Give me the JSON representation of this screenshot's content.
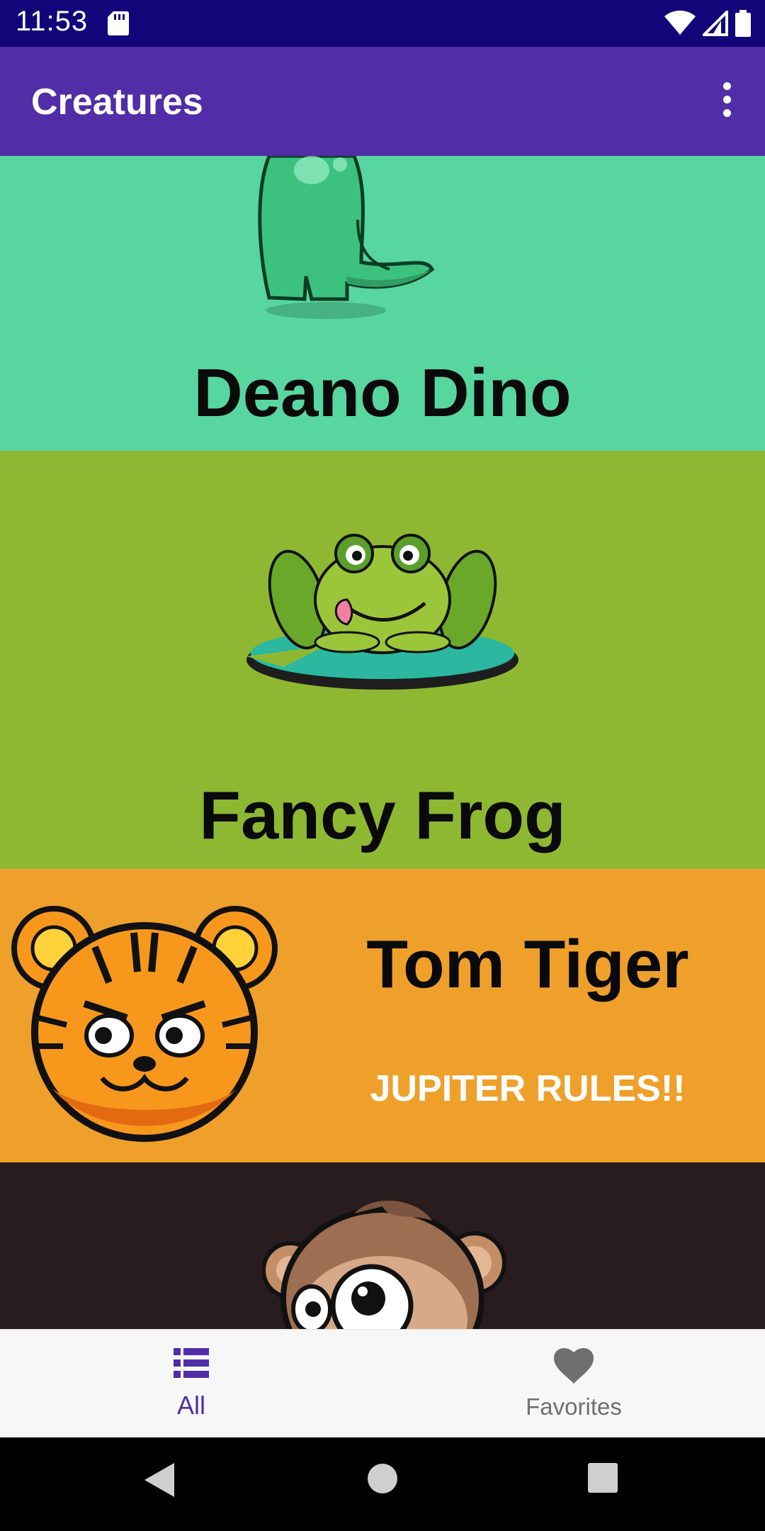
{
  "status_bar": {
    "time": "11:53",
    "icons": [
      "sd-card-icon",
      "wifi-icon",
      "signal-icon",
      "battery-icon"
    ]
  },
  "app_bar": {
    "title": "Creatures",
    "menu_icon": "more-vert-icon"
  },
  "creatures": [
    {
      "name": "Deano Dino",
      "background": "#58d6a0",
      "image": "dino-image"
    },
    {
      "name": "Fancy Frog",
      "background": "#8fb832",
      "image": "frog-image"
    },
    {
      "name": "Tom Tiger",
      "quote": "JUPITER RULES!!",
      "background": "#efa02b",
      "image": "tiger-image"
    },
    {
      "background": "#281c1e",
      "image": "monkey-image"
    }
  ],
  "bottom_nav": {
    "items": [
      {
        "label": "All",
        "icon": "list-icon",
        "selected": true
      },
      {
        "label": "Favorites",
        "icon": "heart-icon",
        "selected": false
      }
    ],
    "active_color": "#512da8",
    "inactive_color": "#6f6f6f"
  },
  "system_nav": {
    "buttons": [
      "back-icon",
      "home-icon",
      "recents-icon"
    ]
  },
  "colors": {
    "status_bar": "#12057a",
    "app_bar": "#512da8"
  }
}
